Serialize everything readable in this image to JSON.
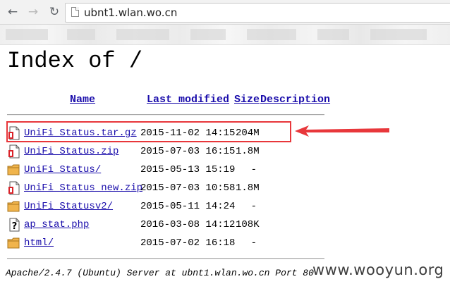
{
  "browser": {
    "back_icon": "back-arrow-icon",
    "forward_icon": "forward-arrow-icon",
    "reload_icon": "reload-icon",
    "url": "ubnt1.wlan.wo.cn"
  },
  "page": {
    "title": "Index of /",
    "columns": {
      "name": "Name",
      "last_modified": "Last modified",
      "size": "Size",
      "description": "Description"
    },
    "entries": [
      {
        "name": "UniFi_Status.tar.gz",
        "modified": "2015-11-02 14:15",
        "size": "204M",
        "icon": "archive-file-icon"
      },
      {
        "name": "UniFi_Status.zip",
        "modified": "2015-07-03 16:15",
        "size": "1.8M",
        "icon": "archive-file-icon"
      },
      {
        "name": "UniFi_Status/",
        "modified": "2015-05-13 15:19",
        "size": "-",
        "icon": "folder-icon"
      },
      {
        "name": "UniFi_Status_new.zip",
        "modified": "2015-07-03 10:58",
        "size": "1.8M",
        "icon": "archive-file-icon"
      },
      {
        "name": "UniFi_Statusv2/",
        "modified": "2015-05-11 14:24",
        "size": "-",
        "icon": "folder-icon"
      },
      {
        "name": "ap_stat.php",
        "modified": "2016-03-08 14:12",
        "size": "108K",
        "icon": "unknown-file-icon"
      },
      {
        "name": "html/",
        "modified": "2015-07-02 16:18",
        "size": "-",
        "icon": "folder-icon"
      }
    ],
    "footer": "Apache/2.4.7 (Ubuntu) Server at ubnt1.wlan.wo.cn Port 80"
  },
  "annotation": {
    "highlight_color": "#e8373b"
  },
  "watermark": "www.wooyun.org",
  "colors": {
    "link": "#1a0dab",
    "folder": "#f0b44c",
    "archive_accent": "#d9232a"
  }
}
